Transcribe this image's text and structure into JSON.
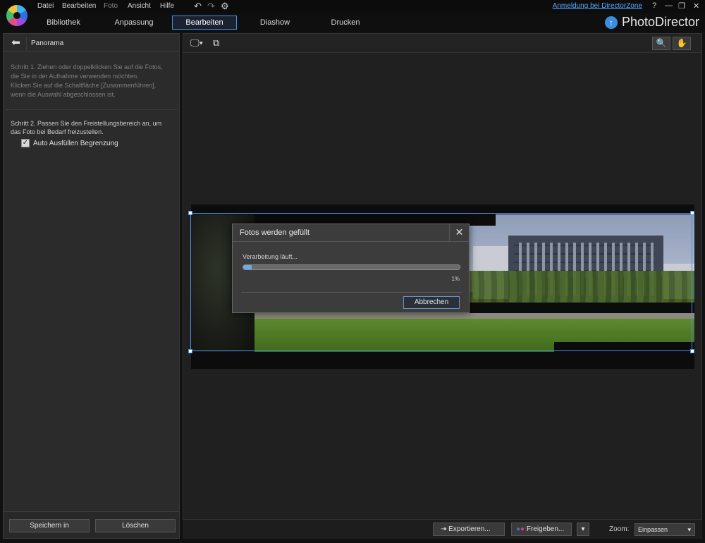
{
  "menu": {
    "items": [
      "Datei",
      "Bearbeiten",
      "Foto",
      "Ansicht",
      "Hilfe"
    ],
    "login_link": "Anmeldung bei DirectorZone",
    "help": "?",
    "minimize": "—",
    "restore": "❐",
    "close": "✕"
  },
  "tabs": [
    "Bibliothek",
    "Anpassung",
    "Bearbeiten",
    "Diashow",
    "Drucken"
  ],
  "active_tab": "Bearbeiten",
  "brand": {
    "name": "PhotoDirector",
    "icon_glyph": "↑"
  },
  "left_panel": {
    "title": "Panorama",
    "step1": "Schritt 1. Ziehen oder doppelklicken Sie auf die Fotos,\ndie Sie in der Aufnahme verwenden möchten.\nKlicken Sie auf die Schaltfläche [Zusammenführen],\nwenn die Auswahl abgeschlossen ist.",
    "step2": "Schritt 2. Passen Sie den Freistellungsbereich an, um\ndas Foto bei Bedarf freizustellen.",
    "checkbox_label": "Auto Ausfüllen Begrenzung",
    "checkbox_checked": true,
    "save_button": "Speichern in",
    "delete_button": "Löschen"
  },
  "dialog": {
    "title": "Fotos werden gefüllt",
    "status": "Verarbeitung läuft...",
    "progress_fraction": 0.04,
    "progress_text": "1%",
    "cancel_button": "Abbrechen"
  },
  "bottom": {
    "export_button": "Exportieren...",
    "share_button": "Freigeben...",
    "zoom_label": "Zoom:",
    "zoom_value": "Einpassen"
  },
  "colors": {
    "accent": "#4a90e2",
    "progress": "#6ea9e6",
    "link": "#5aa8ff"
  }
}
